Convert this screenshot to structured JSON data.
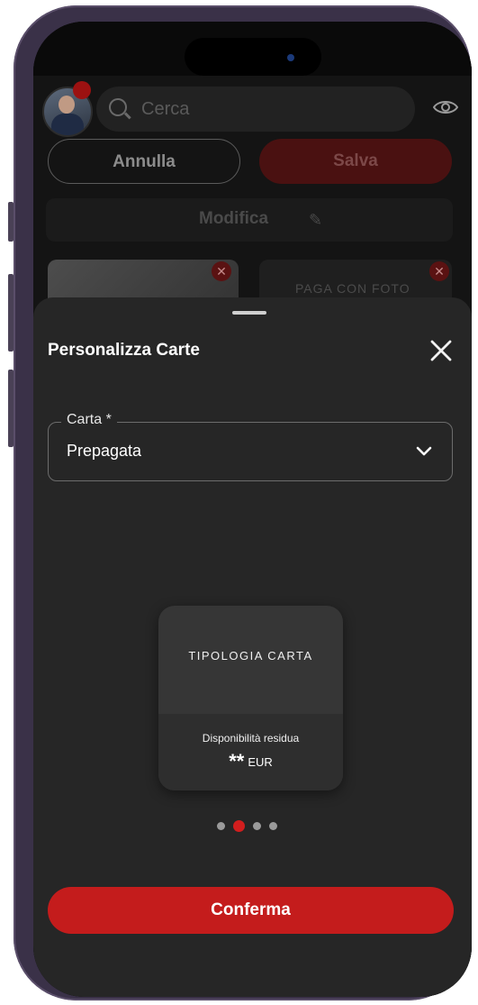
{
  "background_app": {
    "search_placeholder": "Cerca",
    "cancel_label": "Annulla",
    "save_label": "Salva",
    "edit_label": "Modifica",
    "card2_label": "PAGA CON FOTO"
  },
  "sheet": {
    "title": "Personalizza Carte",
    "field": {
      "label": "Carta *",
      "value": "Prepagata"
    },
    "card_preview": {
      "type_label": "TIPOLOGIA CARTA",
      "availability_label": "Disponibilità residua",
      "amount": "**",
      "currency": "EUR"
    },
    "pager": {
      "count": 4,
      "active_index": 1
    },
    "confirm_label": "Conferma"
  },
  "colors": {
    "accent": "#c41c1c",
    "sheet_bg": "#262626",
    "frame": "#3a3148"
  },
  "icons": [
    "search-icon",
    "eye-icon",
    "close-icon",
    "chevron-down-icon",
    "pencil-icon"
  ]
}
